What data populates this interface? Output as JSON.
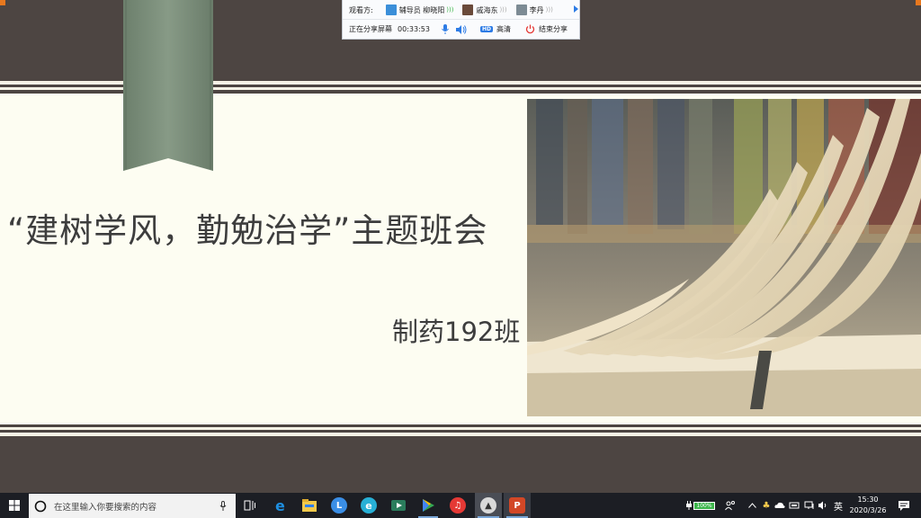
{
  "share_panel": {
    "viewers_label": "观看方:",
    "viewers": [
      {
        "name": "辅导员 柳晓阳",
        "active": true
      },
      {
        "name": "戚海东",
        "active": false
      },
      {
        "name": "李丹",
        "active": false
      }
    ],
    "status_label": "正在分享屏幕",
    "elapsed": "00:33:53",
    "hd_badge": "HD",
    "quality_label": "高清",
    "end_label": "结束分享"
  },
  "slide": {
    "title": "“建树学风，勤勉治学”主题班会",
    "subtitle": "制药192班"
  },
  "taskbar": {
    "search_placeholder": "在这里输入你要搜索的内容",
    "battery": "100%",
    "ime": "英",
    "time": "15:30",
    "date": "2020/3/26"
  },
  "colors": {
    "slide_band": "#fdfdf2",
    "slide_dark": "#4d4542",
    "ribbon": "#7a8c79",
    "accent_blue": "#2c7be5"
  }
}
